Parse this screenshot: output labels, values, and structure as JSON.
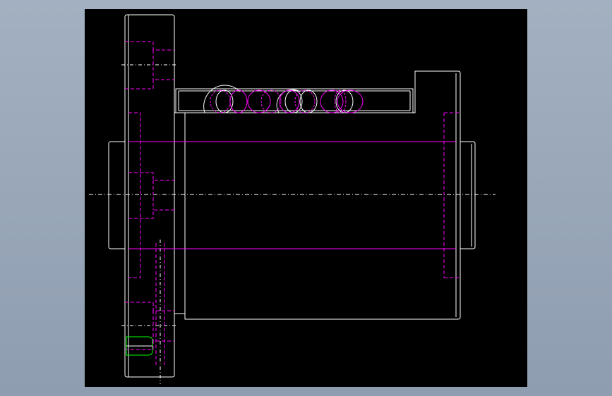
{
  "colors": {
    "background": "#9aa8ba",
    "viewport": "#000000",
    "outline": "#ffffff",
    "hidden": "#ff00ff",
    "highlight": "#00ff00"
  }
}
